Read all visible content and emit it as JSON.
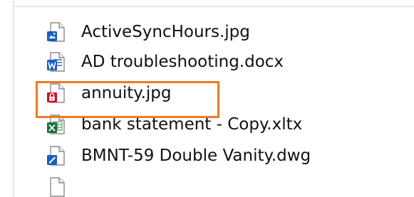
{
  "files": [
    {
      "name": "ActiveSyncHours.jpg",
      "icon": "image-file-icon",
      "badge_color": "#1b5fbf"
    },
    {
      "name": "AD troubleshooting.docx",
      "icon": "word-doc-file-icon",
      "badge_color": "#1b5fbf"
    },
    {
      "name": "annuity.jpg",
      "icon": "locked-image-file-icon",
      "badge_color": "#c8102e",
      "highlighted": true
    },
    {
      "name": "bank statement - Copy.xltx",
      "icon": "excel-template-file-icon",
      "badge_color": "#1d6f42"
    },
    {
      "name": "BMNT-59 Double Vanity.dwg",
      "icon": "drawing-file-icon",
      "badge_color": "#1b5fbf"
    }
  ],
  "highlight": {
    "color": "#f07a24"
  }
}
